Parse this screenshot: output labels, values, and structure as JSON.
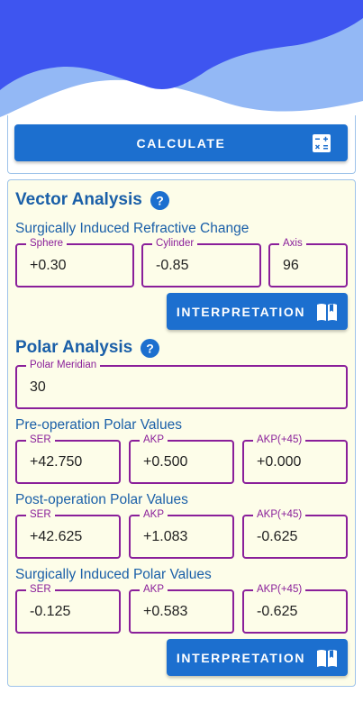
{
  "colors": {
    "wave_dark": "#3e55f0",
    "wave_light": "#93b8f5",
    "button": "#1c6fcf",
    "panel_bg": "#fdfde9",
    "field_border": "#8a1f9a",
    "heading": "#1a5fa8"
  },
  "calculate_button": {
    "label": "CALCULATE",
    "icon": "calculator-icon"
  },
  "vector_analysis": {
    "title": "Vector Analysis",
    "subtitle": "Surgically Induced Refractive Change",
    "sphere": {
      "label": "Sphere",
      "value": "+0.30"
    },
    "cylinder": {
      "label": "Cylinder",
      "value": "-0.85"
    },
    "axis": {
      "label": "Axis",
      "value": "96"
    },
    "interpretation_label": "INTERPRETATION"
  },
  "polar_analysis": {
    "title": "Polar Analysis",
    "meridian": {
      "label": "Polar Meridian",
      "value": "30"
    },
    "pre_op": {
      "title": "Pre-operation Polar Values",
      "ser": {
        "label": "SER",
        "value": "+42.750"
      },
      "akp": {
        "label": "AKP",
        "value": "+0.500"
      },
      "akp45": {
        "label": "AKP(+45)",
        "value": "+0.000"
      }
    },
    "post_op": {
      "title": "Post-operation Polar Values",
      "ser": {
        "label": "SER",
        "value": "+42.625"
      },
      "akp": {
        "label": "AKP",
        "value": "+1.083"
      },
      "akp45": {
        "label": "AKP(+45)",
        "value": "-0.625"
      }
    },
    "induced": {
      "title": "Surgically Induced Polar Values",
      "ser": {
        "label": "SER",
        "value": "-0.125"
      },
      "akp": {
        "label": "AKP",
        "value": "+0.583"
      },
      "akp45": {
        "label": "AKP(+45)",
        "value": "-0.625"
      }
    },
    "interpretation_label": "INTERPRETATION"
  }
}
